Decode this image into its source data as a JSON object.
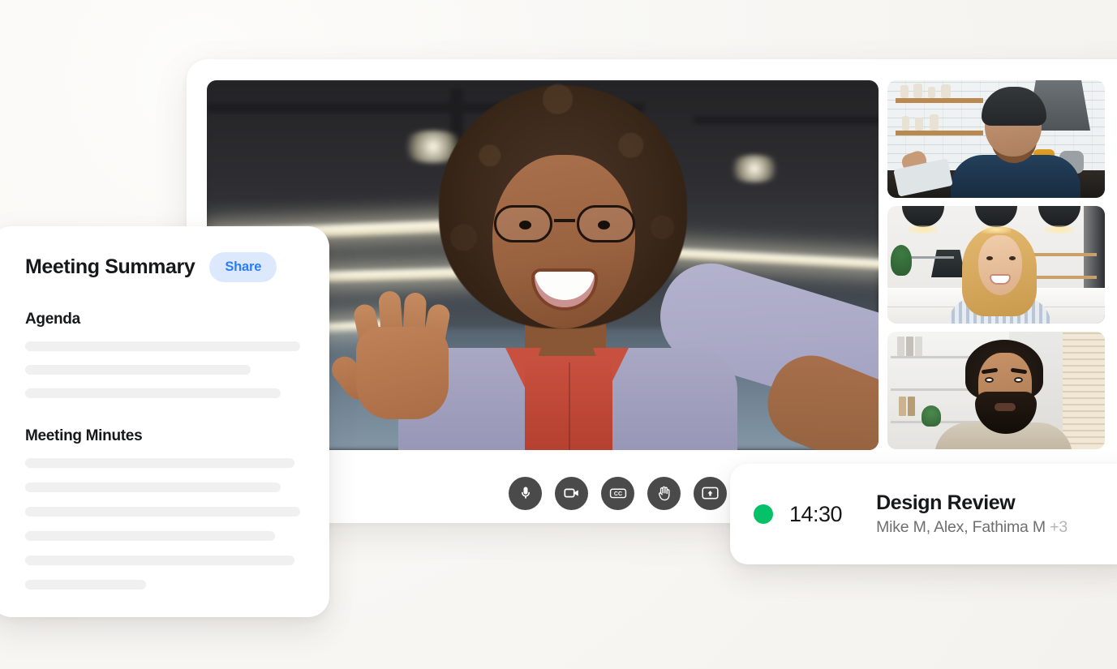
{
  "background": {
    "color": "#faf9f7"
  },
  "app_window": {
    "main_tile": {
      "label": "main-speaker-video"
    },
    "thumbnails": [
      {
        "label": "participant-video-1"
      },
      {
        "label": "participant-video-2"
      },
      {
        "label": "participant-video-3"
      }
    ],
    "controls": [
      {
        "icon": "microphone-icon",
        "name": "mic-button"
      },
      {
        "icon": "video-camera-icon",
        "name": "camera-button"
      },
      {
        "icon": "closed-captions-icon",
        "name": "captions-button",
        "text": "CC"
      },
      {
        "icon": "raise-hand-icon",
        "name": "raise-hand-button"
      },
      {
        "icon": "screen-share-icon",
        "name": "screen-share-button"
      },
      {
        "icon": "more-options-icon",
        "name": "more-options-button"
      }
    ]
  },
  "summary_card": {
    "title": "Meeting Summary",
    "share_label": "Share",
    "share_bg": "#dce9fd",
    "share_fg": "#2b7cfb",
    "sections": [
      {
        "heading": "Agenda",
        "line_widths": [
          "100%",
          "82%",
          "93%"
        ]
      },
      {
        "heading": "Meeting Minutes",
        "line_widths": [
          "98%",
          "93%",
          "100%",
          "91%",
          "98%",
          "44%"
        ]
      }
    ],
    "skeleton_color": "#f0f0f0"
  },
  "meeting_card": {
    "status_color": "#06c167",
    "time": "14:30",
    "title": "Design Review",
    "participants": "Mike M, Alex, Fathima M",
    "extra_count": "+3"
  }
}
